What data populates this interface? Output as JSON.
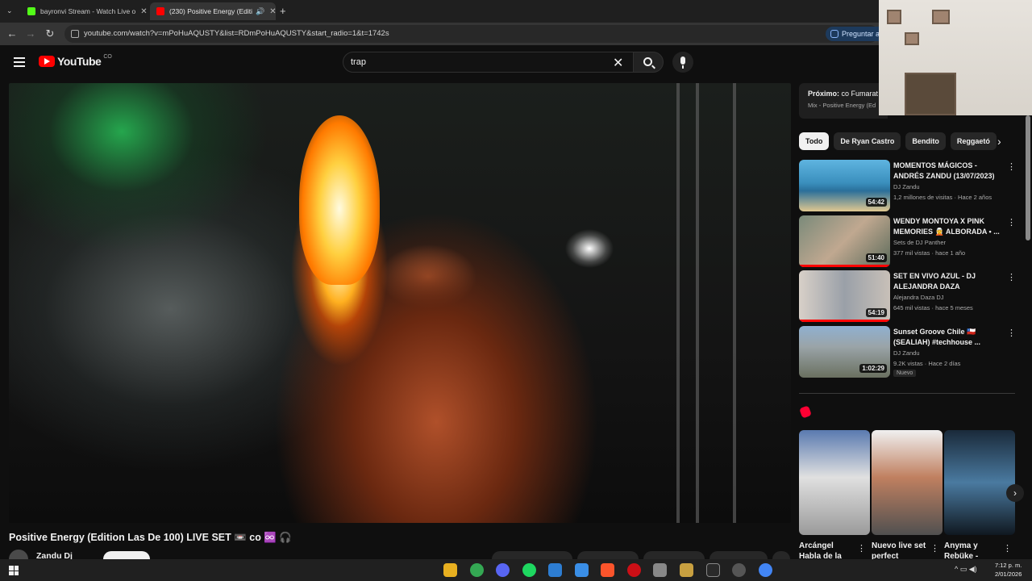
{
  "browser": {
    "tabs": [
      {
        "label": "bayronvi Stream - Watch Live o",
        "favicon_color": "#53fc18",
        "active": false
      },
      {
        "label": "(230) Positive Energy (Editi",
        "favicon_color": "#ff0000",
        "active": true
      }
    ],
    "new_tab": "+",
    "url": "youtube.com/watch?v=mPoHuAQUSTY&list=RDmPoHuAQUSTY&start_radio=1&t=1742s",
    "ask_button": "Preguntar a"
  },
  "header": {
    "logo_text": "YouTube",
    "logo_country": "CO",
    "search_value": "trap"
  },
  "video": {
    "title": "Positive Energy (Edition Las De 100) LIVE SET 📼 co ♾️ 🎧",
    "channel": "Zandu Dj"
  },
  "sidebar": {
    "next_label": "Próximo:",
    "next_title": "co Fumarat",
    "next_sub": "Mix - Positive Energy (Ed",
    "chips": [
      "Todo",
      "De Ryan Castro",
      "Bendito",
      "Reggaetó"
    ],
    "recommendations": [
      {
        "title": "MOMENTOS MÁGICOS - ANDRÉS ZANDU (13/07/2023)",
        "channel": "DJ Zandu",
        "meta": "1,2 millones de visitas · Hace 2 años",
        "duration": "54:42",
        "badge": ""
      },
      {
        "title": "WENDY MONTOYA X PINK MEMORIES 🧝 ALBORADA • ...",
        "channel": "Sets de DJ Panther",
        "meta": "377 mil vistas · hace 1 año",
        "duration": "51:40",
        "badge": ""
      },
      {
        "title": "SET EN VIVO AZUL - DJ ALEJANDRA DAZA",
        "channel": "Alejandra Daza DJ",
        "meta": "645 mil vistas · hace 5 meses",
        "duration": "54:19",
        "badge": ""
      },
      {
        "title": "Sunset Groove Chile 🇨🇱 (SEALIAH) #techhouse ...",
        "channel": "DJ Zandu",
        "meta": "9.2K vistas · Hace 2 días",
        "duration": "1:02:29",
        "badge": "Nuevo"
      }
    ],
    "shorts": [
      {
        "title": "Arcángel Habla de la"
      },
      {
        "title": "Nuevo live set perfect"
      },
      {
        "title": "Anyma y Rebüke -"
      }
    ]
  },
  "taskbar": {
    "time": "7:12 p. m.",
    "date": "2/01/2026"
  },
  "colors": {
    "youtube_red": "#ff0000",
    "background": "#0f0f0f",
    "chip_active": "#f1f1f1"
  }
}
